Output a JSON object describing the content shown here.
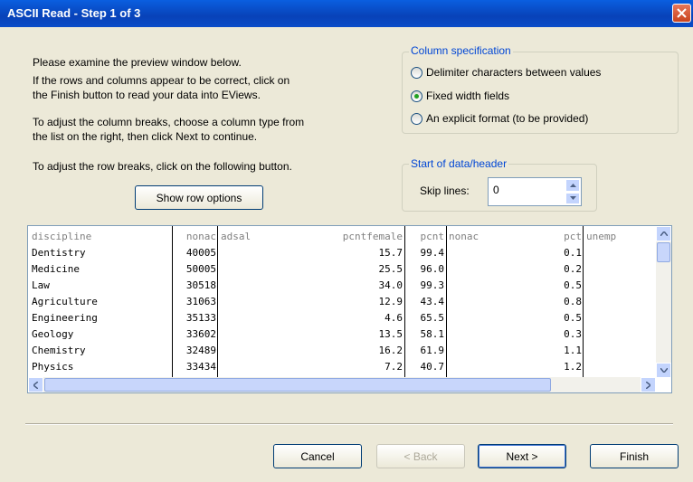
{
  "window": {
    "title": "ASCII Read - Step 1 of 3"
  },
  "instructions": {
    "line1": "Please examine the preview window below.",
    "line2a": "If the rows and columns appear to be correct, click on",
    "line2b": "the Finish button to read your data into EViews.",
    "line3a": "To adjust the column breaks, choose a column type from",
    "line3b": "the list on the right, then click Next to continue.",
    "line4": "To adjust the row breaks, click on the following button."
  },
  "show_row_options_label": "Show row options",
  "column_spec": {
    "title": "Column specification",
    "options": [
      {
        "label": "Delimiter characters between values",
        "checked": false
      },
      {
        "label": "Fixed width fields",
        "checked": true
      },
      {
        "label": "An explicit format (to be provided)",
        "checked": false
      }
    ]
  },
  "start_data": {
    "title": "Start of data/header",
    "skip_label": "Skip lines:",
    "skip_value": "0"
  },
  "preview": {
    "headers": [
      "discipline",
      "nonac",
      "adsal",
      "pcntfemale",
      "pcnt",
      "nonac",
      "pct",
      "unemp"
    ],
    "rows": [
      [
        "Dentistry",
        "40005",
        "",
        "15.7",
        "99.4",
        "",
        "0.1",
        ""
      ],
      [
        "Medicine",
        "50005",
        "",
        "25.5",
        "96.0",
        "",
        "0.2",
        ""
      ],
      [
        "Law",
        "30518",
        "",
        "34.0",
        "99.3",
        "",
        "0.5",
        ""
      ],
      [
        "Agriculture",
        "31063",
        "",
        "12.9",
        "43.4",
        "",
        "0.8",
        ""
      ],
      [
        "Engineering",
        "35133",
        "",
        "4.6",
        "65.5",
        "",
        "0.5",
        ""
      ],
      [
        "Geology",
        "33602",
        "",
        "13.5",
        "58.1",
        "",
        "0.3",
        ""
      ],
      [
        "Chemistry",
        "32489",
        "",
        "16.2",
        "61.9",
        "",
        "1.1",
        ""
      ],
      [
        "Physics",
        "33434",
        "",
        "7.2",
        "40.7",
        "",
        "1.2",
        ""
      ]
    ]
  },
  "buttons": {
    "cancel": "Cancel",
    "back": "< Back",
    "next": "Next >",
    "finish": "Finish"
  }
}
